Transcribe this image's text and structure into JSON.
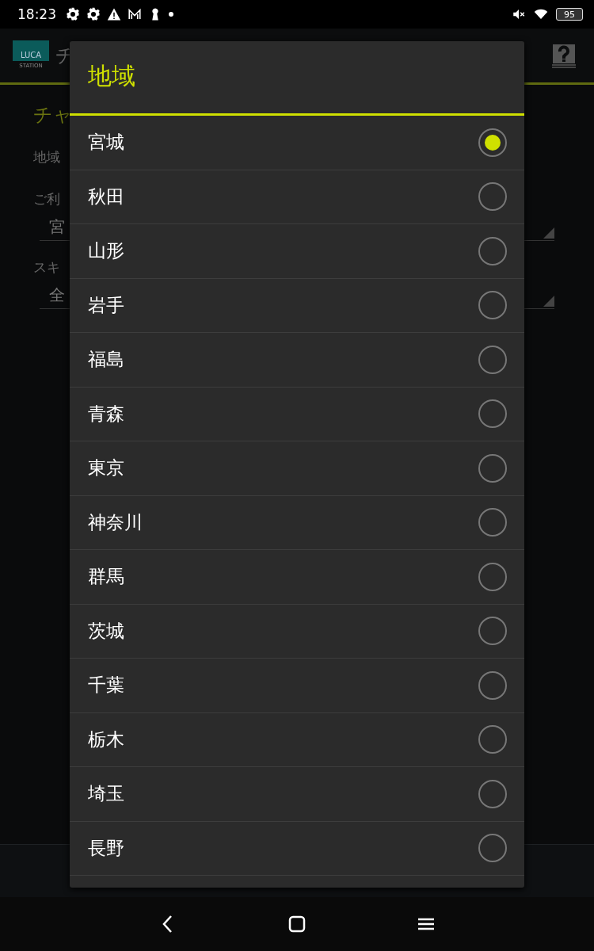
{
  "status_bar": {
    "time": "18:23",
    "battery": "95"
  },
  "app_bar": {
    "logo": {
      "name": "LUCA",
      "sub": "STATION"
    },
    "title": "チ"
  },
  "screen": {
    "heading": "チャ",
    "intro": "地域",
    "fields": [
      {
        "label": "ご利",
        "value": "宮"
      },
      {
        "label": "スキ",
        "value": "全"
      }
    ]
  },
  "dialog": {
    "title": "地域",
    "options": [
      {
        "label": "宮城",
        "selected": true
      },
      {
        "label": "秋田",
        "selected": false
      },
      {
        "label": "山形",
        "selected": false
      },
      {
        "label": "岩手",
        "selected": false
      },
      {
        "label": "福島",
        "selected": false
      },
      {
        "label": "青森",
        "selected": false
      },
      {
        "label": "東京",
        "selected": false
      },
      {
        "label": "神奈川",
        "selected": false
      },
      {
        "label": "群馬",
        "selected": false
      },
      {
        "label": "茨城",
        "selected": false
      },
      {
        "label": "千葉",
        "selected": false
      },
      {
        "label": "栃木",
        "selected": false
      },
      {
        "label": "埼玉",
        "selected": false
      },
      {
        "label": "長野",
        "selected": false
      }
    ]
  }
}
